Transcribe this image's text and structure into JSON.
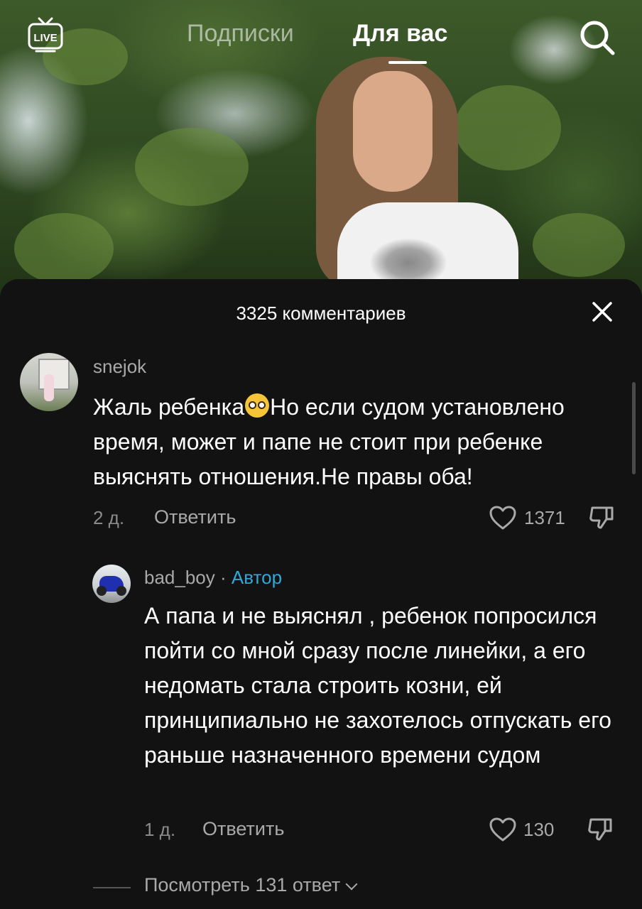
{
  "topnav": {
    "live_label": "LIVE",
    "tab_following": "Подписки",
    "tab_foryou": "Для вас"
  },
  "comments_sheet": {
    "title": "3325 комментариев",
    "comments": [
      {
        "username": "snejok",
        "text_before_emoji": "Жаль ребенка",
        "emoji": "pleading-face-emoji",
        "text_after_emoji": "Но если судом установлено время, может и папе не стоит при ребенке выяснять отношения.Не правы оба!",
        "age": "2 д.",
        "reply_label": "Ответить",
        "likes": "1371"
      },
      {
        "username": "bad_boy",
        "separator": "·",
        "badge": "Автор",
        "text": "А папа и не выяснял , ребенок попросился пойти со мной сразу после линейки, а его недомать стала строить козни, ей принципиально не захотелось отпускать его раньше назначенного времени судом",
        "age": "1 д.",
        "reply_label": "Ответить",
        "likes": "130"
      }
    ],
    "view_replies_label": "Посмотреть 131 ответ"
  },
  "colors": {
    "sheet_background": "#121212",
    "author_badge": "#2fa9d8",
    "secondary_text": "#a9a9a9"
  }
}
